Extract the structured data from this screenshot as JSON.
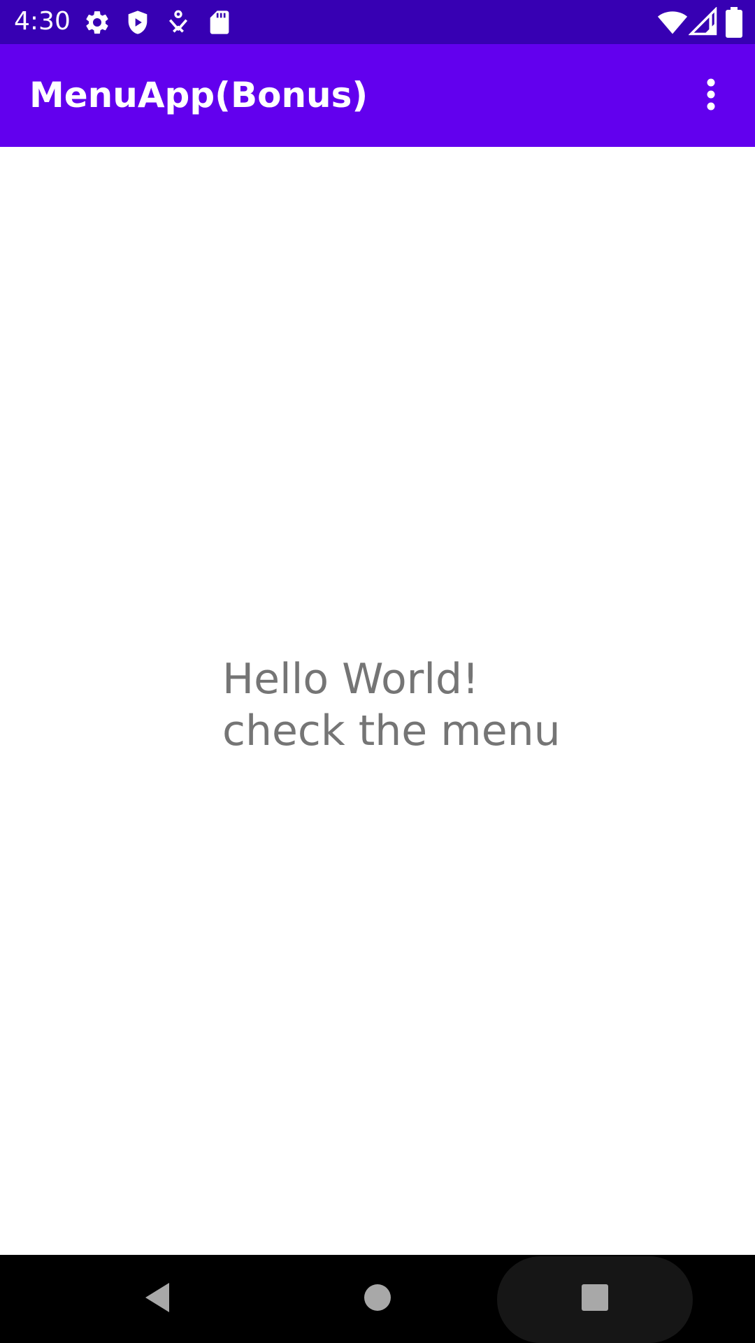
{
  "status_bar": {
    "time": "4:30",
    "background": "#3700B3",
    "left_icons": [
      "settings-gear-icon",
      "shield-play-icon",
      "accessibility-icon",
      "sd-card-icon"
    ],
    "right_icons": [
      "wifi-icon",
      "cellular-signal-icon",
      "battery-icon"
    ]
  },
  "app_bar": {
    "title": "MenuApp(Bonus)",
    "background": "#6200EE",
    "overflow_icon": "more-vert-icon"
  },
  "content": {
    "message": "Hello World!\ncheck the menu",
    "text_color": "#757575"
  },
  "nav_bar": {
    "buttons": [
      "back-icon",
      "home-icon",
      "recents-icon"
    ]
  }
}
